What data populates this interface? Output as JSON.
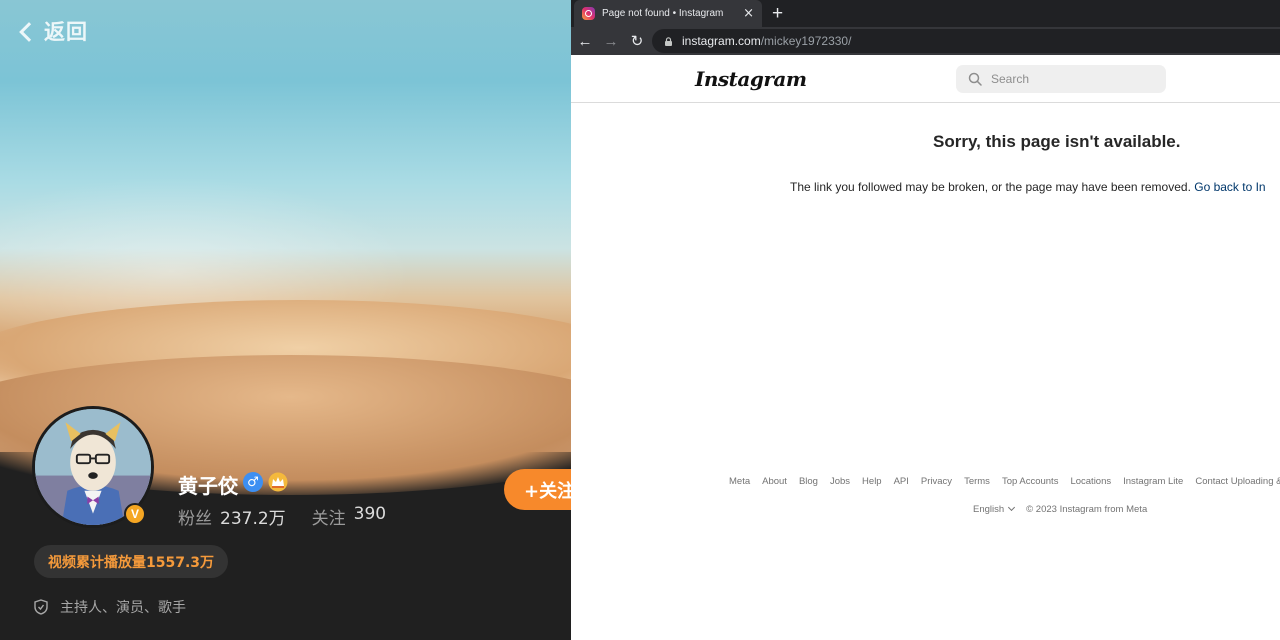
{
  "left_profile": {
    "back_label": "返回",
    "name": "黄子佼",
    "verified_badge": "V",
    "gender_symbol": "♂",
    "followers_label": "粉丝",
    "followers_value": "237.2万",
    "following_label": "关注",
    "following_value": "390",
    "follow_button": "+关注",
    "play_count": "视频累计播放量1557.3万",
    "tags": "主持人、演员、歌手",
    "colors": {
      "accent": "#f7892b",
      "verified": "#f5a623",
      "gender": "#3d8ff2",
      "panel": "#202020"
    }
  },
  "browser": {
    "tab_title": "Page not found • Instagram",
    "tab_close": "×",
    "new_tab": "+",
    "url_host": "instagram.com",
    "url_path": "/mickey1972330/",
    "nav": {
      "back": "←",
      "forward": "→",
      "reload": "↻"
    }
  },
  "instagram": {
    "logo": "Instagram",
    "search_placeholder": "Search",
    "error_title": "Sorry, this page isn't available.",
    "error_desc": "The link you followed may be broken, or the page may have been removed. ",
    "error_link": "Go back to In",
    "footer_links": [
      "Meta",
      "About",
      "Blog",
      "Jobs",
      "Help",
      "API",
      "Privacy",
      "Terms",
      "Top Accounts",
      "Locations",
      "Instagram Lite",
      "Contact Uploading &"
    ],
    "language": "English",
    "copyright": "© 2023 Instagram from Meta",
    "colors": {
      "link": "#00376b",
      "muted": "#737373"
    }
  }
}
